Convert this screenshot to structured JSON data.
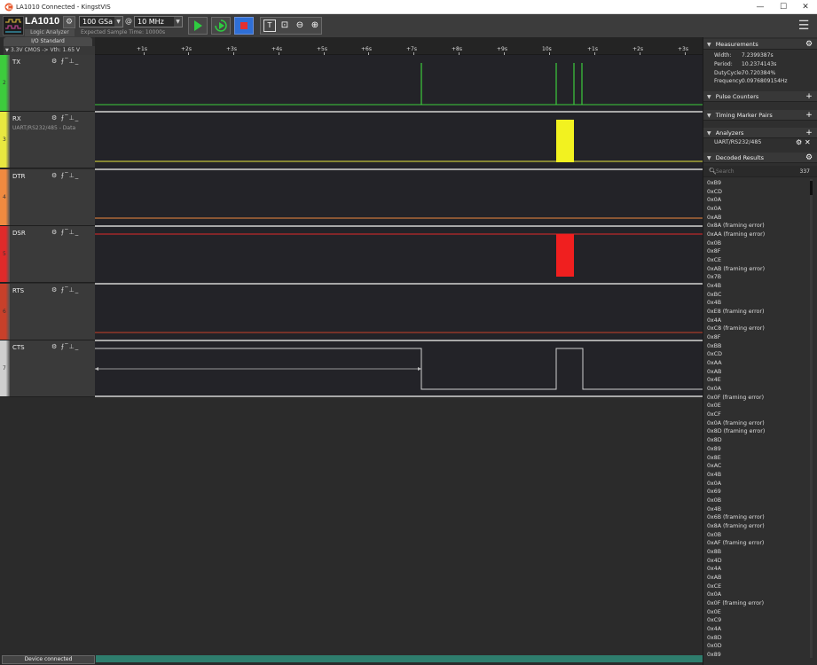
{
  "window": {
    "title": "LA1010 Connected - KingstVIS",
    "controls": [
      "—",
      "☐",
      "✕"
    ]
  },
  "toolbar": {
    "device_name": "LA1010",
    "device_subtitle": "Logic Analyzer",
    "sample_depth": "100 GSa",
    "at_sign": "@",
    "sample_rate": "10 MHz",
    "expected_time": "Expected Sample Time: 10000s",
    "colors": {
      "run": "#2ecc40",
      "stop": "#e53030",
      "stop_bg": "#2f6fd6"
    }
  },
  "io_standard": {
    "tab_label": "I/O Standard",
    "value": "3.3V CMOS -> Vth: 1.65 V"
  },
  "channels": [
    {
      "num": "2",
      "name": "TX",
      "desc": "",
      "color": "#3dcc3d"
    },
    {
      "num": "3",
      "name": "RX",
      "desc": "UART/RS232/485 - Data",
      "color": "#e8e840"
    },
    {
      "num": "4",
      "name": "DTR",
      "desc": "",
      "color": "#f08a40"
    },
    {
      "num": "5",
      "name": "DSR",
      "desc": "",
      "color": "#e02a2a"
    },
    {
      "num": "6",
      "name": "RTS",
      "desc": "",
      "color": "#c8402a"
    },
    {
      "num": "7",
      "name": "CTS",
      "desc": "",
      "color": "#cfcfcf"
    }
  ],
  "ruler": {
    "ticks": [
      "+1s",
      "+2s",
      "+3s",
      "+4s",
      "+5s",
      "+6s",
      "+7s",
      "+8s",
      "+9s",
      "10s",
      "+1s",
      "+2s",
      "+3s"
    ]
  },
  "right_panel": {
    "measurements": {
      "title": "Measurements",
      "rows": [
        {
          "label": "Width:",
          "value": "7.2399387s"
        },
        {
          "label": "Period:",
          "value": "10.2374143s"
        },
        {
          "label": "DutyCycle:",
          "value": "70.720384%"
        },
        {
          "label": "Frequency:",
          "value": "0.0976809154Hz"
        }
      ]
    },
    "pulse_counters": "Pulse Counters",
    "timing_marker_pairs": "Timing Marker Pairs",
    "analyzers": {
      "title": "Analyzers",
      "items": [
        "UART/RS232/485"
      ]
    },
    "decoded": {
      "title": "Decoded Results",
      "search_placeholder": "Search",
      "count": "337",
      "results": [
        "0xB9",
        "0xCD",
        "0x0A",
        "0x0A",
        "0xAB",
        "0x8A (framing error)",
        "0xAA (framing error)",
        "0x0B",
        "0x8F",
        "0xCE",
        "0xAB (framing error)",
        "0x7B",
        "0x4B",
        "0xBC",
        "0x4B",
        "0xE8 (framing error)",
        "0x4A",
        "0xC8 (framing error)",
        "0x8F",
        "0xBB",
        "0xCD",
        "0xAA",
        "0xAB",
        "0x4E",
        "0x0A",
        "0x0F (framing error)",
        "0x0E",
        "0xCF",
        "0x0A (framing error)",
        "0x8D (framing error)",
        "0x8D",
        "0x89",
        "0x8E",
        "0xAC",
        "0x4B",
        "0x0A",
        "0x69",
        "0x0B",
        "0x4B",
        "0x6B (framing error)",
        "0x8A (framing error)",
        "0x0B",
        "0xAF (framing error)",
        "0x8B",
        "0x4D",
        "0x4A",
        "0xAB",
        "0xCE",
        "0x0A",
        "0x0F (framing error)",
        "0x0E",
        "0xC9",
        "0x4A",
        "0x8D",
        "0x0D",
        "0x89"
      ]
    }
  },
  "status": {
    "device": "Device connected"
  }
}
